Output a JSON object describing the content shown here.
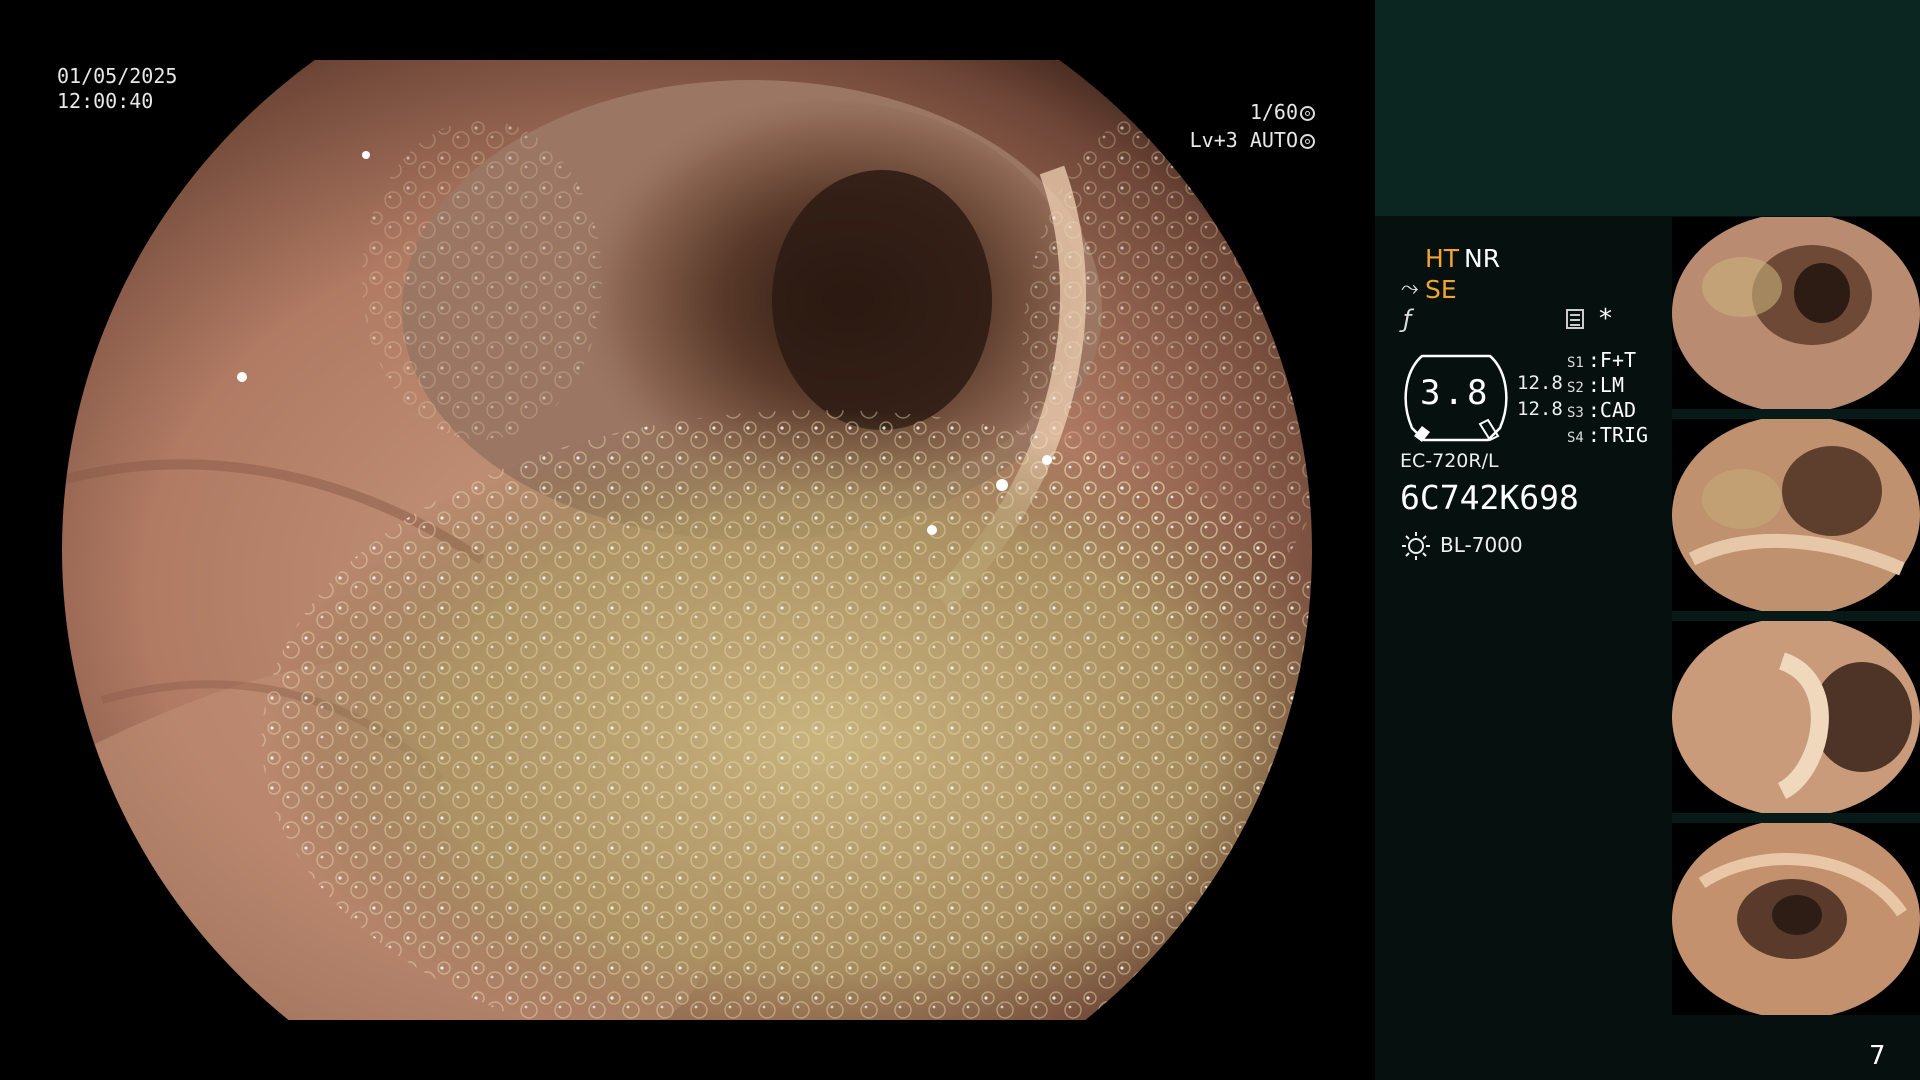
{
  "overlay": {
    "date": "01/05/2025",
    "time": "12:00:40",
    "shutter": "1/60",
    "exposure": "Lv+3 AUTO"
  },
  "modes": {
    "ht": "HT",
    "nr": "NR",
    "se": "SE",
    "star": "*"
  },
  "gauge": {
    "value": "3.8",
    "right_top": "12.8",
    "right_bottom": "12.8"
  },
  "switches": [
    {
      "key": "S1",
      "label": "F+T"
    },
    {
      "key": "S2",
      "label": "LM"
    },
    {
      "key": "S3",
      "label": "CAD"
    },
    {
      "key": "S4",
      "label": "TRIG"
    }
  ],
  "scope": {
    "model": "EC-720R/L",
    "serial": "6C742K698"
  },
  "light_source": "BL-7000",
  "page_number": "7",
  "colors": {
    "panel_dark": "#05100f",
    "panel_top": "#0b2520",
    "accent_orange": "#f2a531"
  },
  "icons": [
    "shutter-icon",
    "auto-exposure-icon",
    "scope-bend-icon",
    "filter-icon",
    "grid-memory-icon",
    "light-source-icon"
  ],
  "thumbnails": 4
}
